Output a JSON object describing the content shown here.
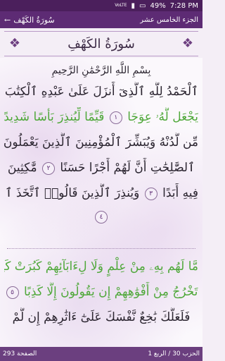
{
  "status": {
    "network": "VoLTE",
    "battery": "49%",
    "time": "7:28 PM"
  },
  "app_bar": {
    "back_label": "سُورَةُ الكَهْف",
    "juz_label": "الجزء الخامس عشر"
  },
  "surah_header": {
    "title": "سُورَةُ الكَهْفِ"
  },
  "verses": {
    "basmala": "بِسْمِ اللَّهِ الرَّحْمَٰنِ الرَّحِيمِ",
    "line1": "ٱلْحَمْدُ لِلَّهِ ٱلَّذِىٓ أَنزَلَ عَلَىٰ عَبْدِهِ ٱلْكِتَٰبَ وَلَمْ",
    "line2_a": "يَجْعَل لَّهُۥ عِوَجَا",
    "marker1": "١",
    "line2_b": "قَيِّمًا لِّيُنذِرَ بَأْسًا شَدِيدًا",
    "line3": "مِّن لَّدُنْهُ وَيُبَشِّرَ ٱلْمُؤْمِنِينَ ٱلَّذِينَ يَعْمَلُونَ",
    "line4_a": "ٱلصَّٰلِحَٰتِ أَنَّ لَهُمْ أَجْرًا حَسَنًا",
    "marker2": "٢",
    "line4_b": "مَّٰكِثِينَ",
    "line5_a": "فِيهِ أَبَدًا",
    "marker3": "٣",
    "line5_b": "وَيُنذِرَ ٱلَّذِينَ قَالُوا۟ ٱتَّخَذَ ٱللَّهُ وَلَدًا",
    "marker4": "٤",
    "line6": "مَّا لَهُم بِهِۦ مِنْ عِلْمٍ وَلَا لِءَابَآئِهِمْ كَبُرَتْ كَلِمَةً",
    "line7_a": "تَخْرُجُ مِنْ أَفْوَٰهِهِمْ إِن يَقُولُونَ إِلَّا كَذِبًا",
    "marker5": "٥",
    "line8": "فَلَعَلَّكَ بَٰخِعٌ نَّفْسَكَ عَلَىٰٓ ءَاثَٰرِهِمْ إِن لَّمْ"
  },
  "footer": {
    "page_label": "الصفحة 293",
    "hizb_label": "الحزب 30 / الربع 1"
  }
}
